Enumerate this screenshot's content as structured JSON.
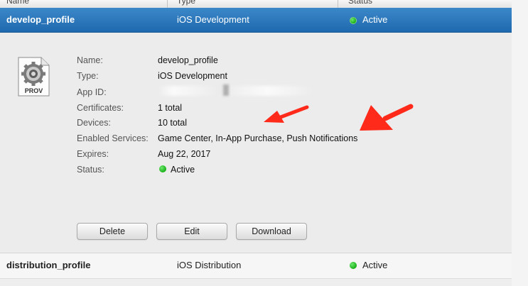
{
  "table": {
    "headers": [
      "Name",
      "Type",
      "Status"
    ]
  },
  "selected_row": {
    "name": "develop_profile",
    "type": "iOS Development",
    "status": "Active"
  },
  "detail": {
    "icon_label": "PROV",
    "fields": [
      {
        "label": "Name:",
        "value": "develop_profile"
      },
      {
        "label": "Type:",
        "value": "iOS Development"
      },
      {
        "label": "App ID:",
        "value": ""
      },
      {
        "label": "Certificates:",
        "value": "1 total"
      },
      {
        "label": "Devices:",
        "value": "10 total"
      },
      {
        "label": "Enabled Services:",
        "value": "Game Center, In-App Purchase, Push Notifications"
      },
      {
        "label": "Expires:",
        "value": "Aug 22, 2017"
      },
      {
        "label": "Status:",
        "value": "Active"
      }
    ],
    "buttons": {
      "delete": "Delete",
      "edit": "Edit",
      "download": "Download"
    }
  },
  "second_row": {
    "name": "distribution_profile",
    "type": "iOS Distribution",
    "status": "Active"
  },
  "colors": {
    "selection": "#2a78bd",
    "active_dot": "#22b422",
    "annotation_arrow": "#ff2a1a"
  }
}
